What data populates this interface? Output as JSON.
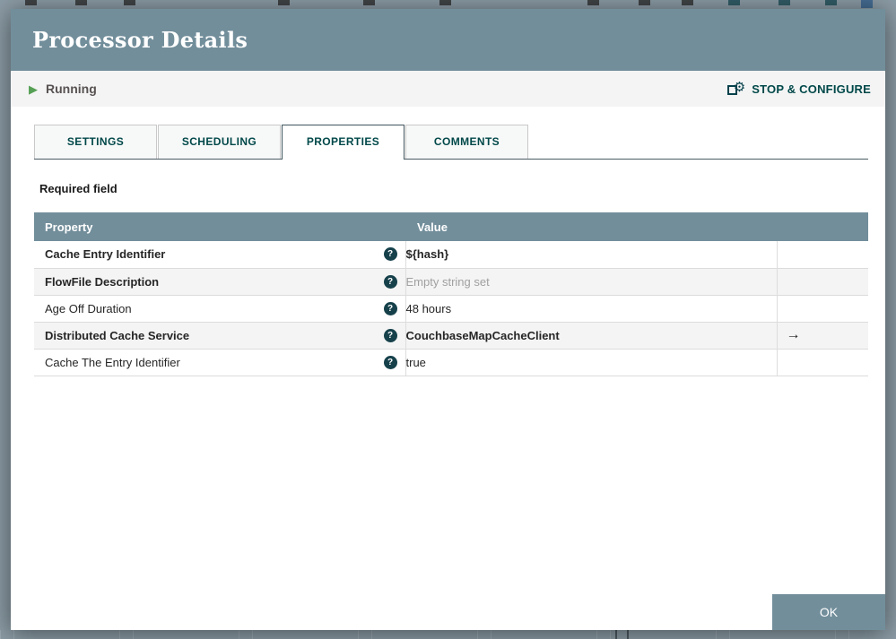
{
  "icons": {
    "run": "▶",
    "stop_configure": "⚙",
    "help": "?",
    "goto": "→"
  },
  "colors": {
    "header_bg": "#728e9b",
    "accent_teal": "#004849",
    "running_green": "#55a055",
    "row_alt_bg": "#f4f4f4",
    "backdrop": "#8c9ca6"
  },
  "dialog": {
    "title": "Processor Details",
    "status": {
      "label": "Running"
    },
    "actions": {
      "stop_configure": "STOP & CONFIGURE",
      "ok": "OK"
    },
    "tabs": [
      {
        "label": "SETTINGS",
        "active": false
      },
      {
        "label": "SCHEDULING",
        "active": false
      },
      {
        "label": "PROPERTIES",
        "active": true
      },
      {
        "label": "COMMENTS",
        "active": false
      }
    ],
    "required_note": "Required field",
    "table": {
      "headers": {
        "property": "Property",
        "value": "Value"
      },
      "rows": [
        {
          "property": "Cache Entry Identifier",
          "value": "${hash}",
          "required": true,
          "value_set": true,
          "goto": false
        },
        {
          "property": "FlowFile Description",
          "value": "Empty string set",
          "required": true,
          "value_set": false,
          "goto": false
        },
        {
          "property": "Age Off Duration",
          "value": "48 hours",
          "required": false,
          "value_set": true,
          "goto": false
        },
        {
          "property": "Distributed Cache Service",
          "value": "CouchbaseMapCacheClient",
          "required": true,
          "value_set": true,
          "goto": true
        },
        {
          "property": "Cache The Entry Identifier",
          "value": "true",
          "required": false,
          "value_set": true,
          "goto": false
        }
      ]
    }
  }
}
